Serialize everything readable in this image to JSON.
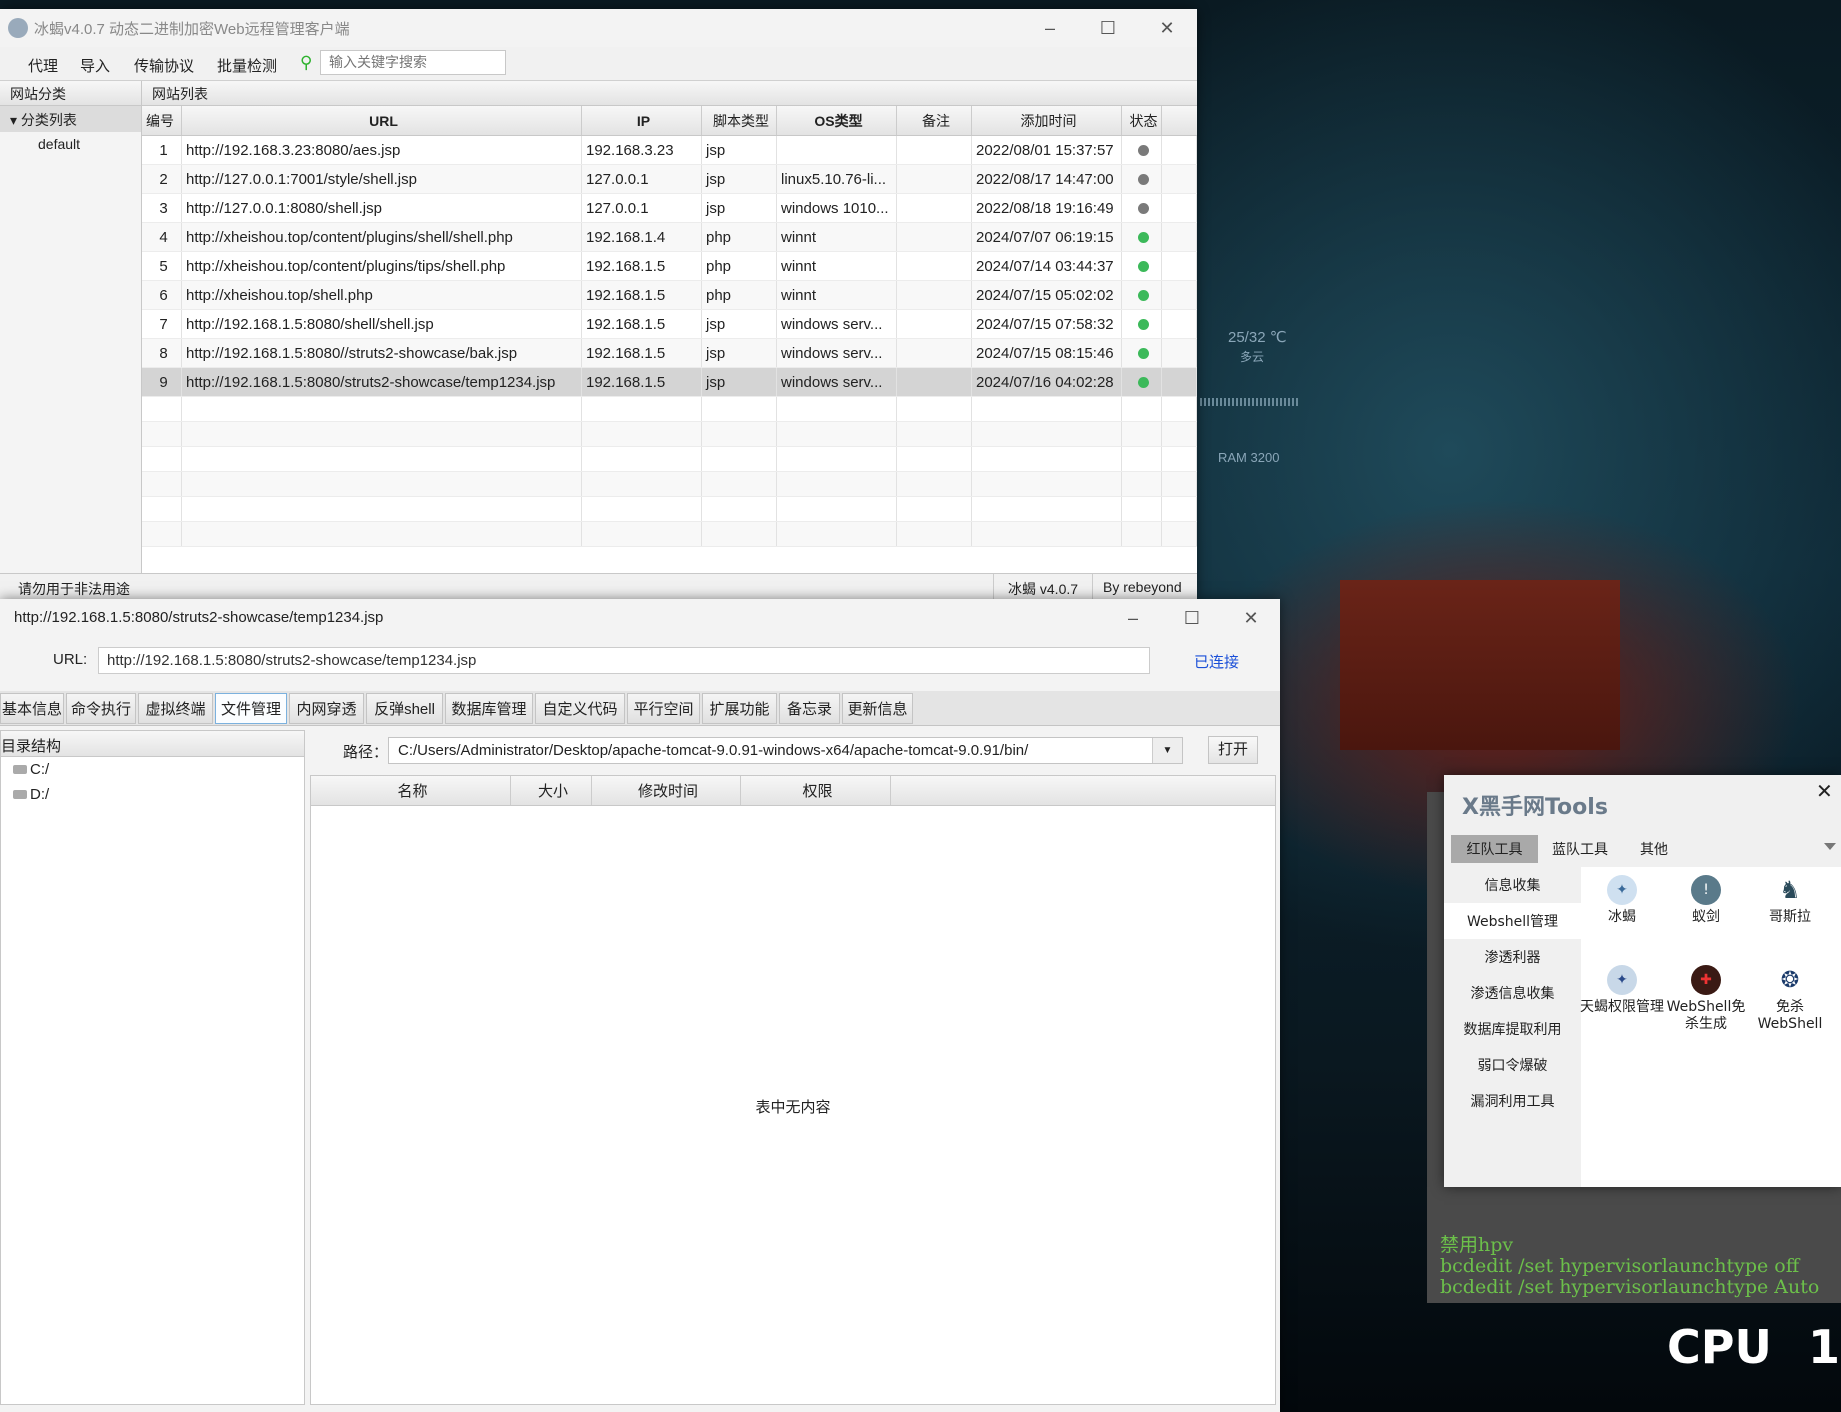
{
  "wallpaper": {
    "weather": "25/32 ℃",
    "weather_desc": "多云",
    "ram": "RAM 3200",
    "cpu": "CPU",
    "cpu_value": "1"
  },
  "main_window": {
    "title": "冰蝎v4.0.7 动态二进制加密Web远程管理客户端",
    "menu": [
      "代理",
      "导入",
      "传输协议",
      "批量检测"
    ],
    "search_placeholder": "输入关键字搜索",
    "sidebar": {
      "header": "网站分类",
      "group": "分类列表",
      "items": [
        "default"
      ]
    },
    "list_header": "网站列表",
    "columns": [
      "编号",
      "URL",
      "IP",
      "脚本类型",
      "OS类型",
      "备注",
      "添加时间",
      "状态"
    ],
    "rows": [
      {
        "id": "1",
        "url": "http://192.168.3.23:8080/aes.jsp",
        "ip": "192.168.3.23",
        "type": "jsp",
        "os": "",
        "note": "",
        "time": "2022/08/01 15:37:57",
        "status": "offline"
      },
      {
        "id": "2",
        "url": "http://127.0.0.1:7001/style/shell.jsp",
        "ip": "127.0.0.1",
        "type": "jsp",
        "os": "linux5.10.76-li...",
        "note": "",
        "time": "2022/08/17 14:47:00",
        "status": "offline"
      },
      {
        "id": "3",
        "url": "http://127.0.0.1:8080/shell.jsp",
        "ip": "127.0.0.1",
        "type": "jsp",
        "os": "windows 1010...",
        "note": "",
        "time": "2022/08/18 19:16:49",
        "status": "offline"
      },
      {
        "id": "4",
        "url": "http://xheishou.top/content/plugins/shell/shell.php",
        "ip": "192.168.1.4",
        "type": "php",
        "os": "winnt",
        "note": "",
        "time": "2024/07/07 06:19:15",
        "status": "online"
      },
      {
        "id": "5",
        "url": "http://xheishou.top/content/plugins/tips/shell.php",
        "ip": "192.168.1.5",
        "type": "php",
        "os": "winnt",
        "note": "",
        "time": "2024/07/14 03:44:37",
        "status": "online"
      },
      {
        "id": "6",
        "url": "http://xheishou.top/shell.php",
        "ip": "192.168.1.5",
        "type": "php",
        "os": "winnt",
        "note": "",
        "time": "2024/07/15 05:02:02",
        "status": "online"
      },
      {
        "id": "7",
        "url": "http://192.168.1.5:8080/shell/shell.jsp",
        "ip": "192.168.1.5",
        "type": "jsp",
        "os": "windows serv...",
        "note": "",
        "time": "2024/07/15 07:58:32",
        "status": "online"
      },
      {
        "id": "8",
        "url": "http://192.168.1.5:8080//struts2-showcase/bak.jsp",
        "ip": "192.168.1.5",
        "type": "jsp",
        "os": "windows serv...",
        "note": "",
        "time": "2024/07/15 08:15:46",
        "status": "online"
      },
      {
        "id": "9",
        "url": "http://192.168.1.5:8080/struts2-showcase/temp1234.jsp",
        "ip": "192.168.1.5",
        "type": "jsp",
        "os": "windows serv...",
        "note": "",
        "time": "2024/07/16 04:02:28",
        "status": "online",
        "selected": true
      }
    ],
    "status_colors": {
      "online": "#3cb95a",
      "offline": "#7a7a7a"
    },
    "statusbar": {
      "left": "请勿用于非法用途",
      "version": "冰蝎 v4.0.7",
      "author": "By rebeyond"
    }
  },
  "shell_window": {
    "title": "http://192.168.1.5:8080/struts2-showcase/temp1234.jsp",
    "url_label": "URL:",
    "url_value": "http://192.168.1.5:8080/struts2-showcase/temp1234.jsp",
    "connection_status": "已连接",
    "tabs": [
      "基本信息",
      "命令执行",
      "虚拟终端",
      "文件管理",
      "内网穿透",
      "反弹shell",
      "数据库管理",
      "自定义代码",
      "平行空间",
      "扩展功能",
      "备忘录",
      "更新信息"
    ],
    "active_tab": "文件管理",
    "tree_header": "目录结构",
    "drives": [
      "C:/",
      "D:/"
    ],
    "path_label": "路径：",
    "path_value": "C:/Users/Administrator/Desktop/apache-tomcat-9.0.91-windows-x64/apache-tomcat-9.0.91/bin/",
    "open_button": "打开",
    "file_columns": [
      "名称",
      "大小",
      "修改时间",
      "权限"
    ],
    "empty_text": "表中无内容"
  },
  "tools_window": {
    "title": "X黑手网Tools",
    "tabs": [
      "红队工具",
      "蓝队工具",
      "其他"
    ],
    "categories": [
      "信息收集",
      "Webshell管理",
      "渗透利器",
      "渗透信息收集",
      "数据库提取利用",
      "弱口令爆破",
      "漏洞利用工具"
    ],
    "selected_category": "Webshell管理",
    "tools": [
      {
        "label": "冰蝎",
        "icon": "scorpion-icon"
      },
      {
        "label": "蚁剑",
        "icon": "antsword-icon"
      },
      {
        "label": "哥斯拉",
        "icon": "godzilla-icon"
      },
      {
        "label": "天蝎权限管理",
        "icon": "tianxie-icon"
      },
      {
        "label": "WebShell免杀生成",
        "icon": "webshell-gen-icon"
      },
      {
        "label": "免杀WebShell",
        "icon": "mianshawebshell-icon"
      }
    ]
  },
  "console": {
    "lines": [
      "禁用hpv",
      "bcdedit /set hypervisorlaunchtype off",
      "bcdedit /set hypervisorlaunchtype Auto"
    ]
  }
}
